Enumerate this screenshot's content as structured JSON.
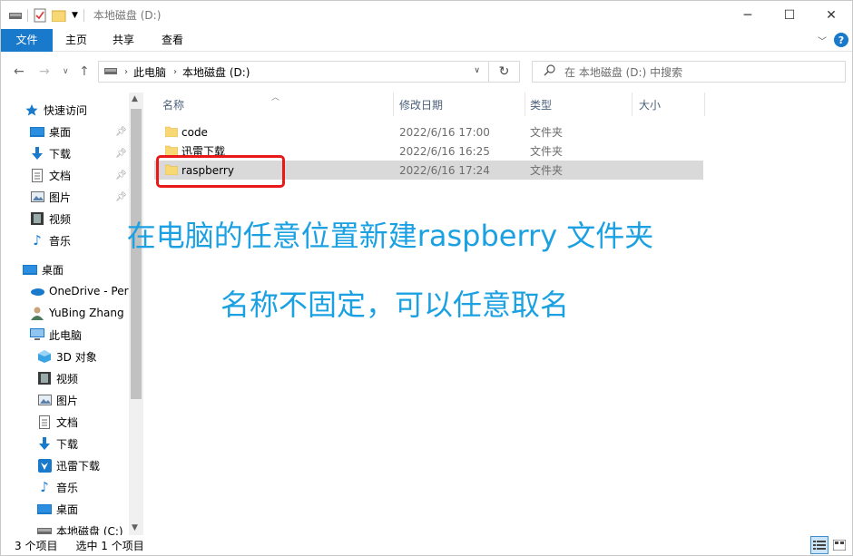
{
  "window": {
    "title": "本地磁盘 (D:)",
    "controls": {
      "minimize": "─",
      "maximize": "☐",
      "close": "✕"
    }
  },
  "ribbon": {
    "tabs": [
      {
        "label": "文件"
      },
      {
        "label": "主页"
      },
      {
        "label": "共享"
      },
      {
        "label": "查看"
      }
    ],
    "help": "?"
  },
  "nav": {
    "breadcrumbs": [
      "此电脑",
      "本地磁盘 (D:)"
    ],
    "search_placeholder": "在 本地磁盘 (D:) 中搜索"
  },
  "sidebar": {
    "items": [
      {
        "label": "快速访问",
        "icon": "star-icon"
      },
      {
        "label": "桌面",
        "icon": "desktop-icon",
        "pinned": true
      },
      {
        "label": "下载",
        "icon": "download-icon",
        "pinned": true
      },
      {
        "label": "文档",
        "icon": "documents-icon",
        "pinned": true
      },
      {
        "label": "图片",
        "icon": "pictures-icon",
        "pinned": true
      },
      {
        "label": "视频",
        "icon": "videos-icon"
      },
      {
        "label": "音乐",
        "icon": "music-icon"
      },
      {
        "label": "桌面",
        "icon": "desktop-icon"
      },
      {
        "label": "OneDrive - Per",
        "icon": "onedrive-icon"
      },
      {
        "label": "YuBing Zhang",
        "icon": "user-icon"
      },
      {
        "label": "此电脑",
        "icon": "computer-icon"
      },
      {
        "label": "3D 对象",
        "icon": "3d-objects-icon"
      },
      {
        "label": "视频",
        "icon": "videos-icon"
      },
      {
        "label": "图片",
        "icon": "pictures-icon"
      },
      {
        "label": "文档",
        "icon": "documents-icon"
      },
      {
        "label": "下载",
        "icon": "download-icon"
      },
      {
        "label": "迅雷下载",
        "icon": "xunlei-icon"
      },
      {
        "label": "音乐",
        "icon": "music-icon"
      },
      {
        "label": "桌面",
        "icon": "desktop-icon"
      },
      {
        "label": "本地磁盘 (C:)",
        "icon": "drive-icon"
      }
    ]
  },
  "columns": {
    "name": "名称",
    "date": "修改日期",
    "type": "类型",
    "size": "大小"
  },
  "files": [
    {
      "name": "code",
      "date": "2022/6/16 17:00",
      "type": "文件夹",
      "selected": false
    },
    {
      "name": "迅雷下载",
      "date": "2022/6/16 16:25",
      "type": "文件夹",
      "selected": false
    },
    {
      "name": "raspberry",
      "date": "2022/6/16 17:24",
      "type": "文件夹",
      "selected": true
    }
  ],
  "annotation": {
    "line1": "在电脑的任意位置新建raspberry 文件夹",
    "line2": "名称不固定，可以任意取名",
    "color": "#1ba1e2",
    "highlight_color": "#e81919"
  },
  "status": {
    "item_count": "3 个项目",
    "selected": "选中 1 个项目"
  },
  "colors": {
    "accent": "#1979ca",
    "folder": "#f8d775"
  }
}
